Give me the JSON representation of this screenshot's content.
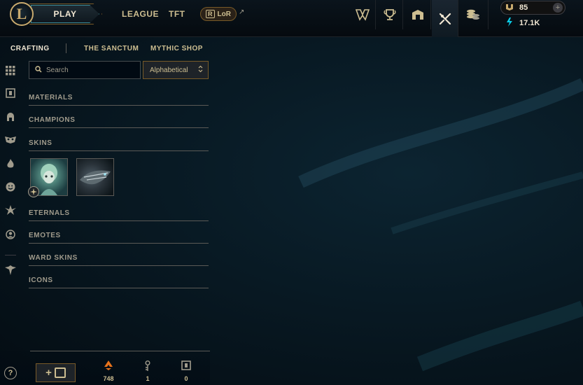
{
  "topbar": {
    "logo_letter": "L",
    "play_label": "PLAY",
    "nav": [
      "LEAGUE",
      "TFT"
    ],
    "lor_label": "LoR",
    "lor_ext_icon": "↗",
    "icons": [
      "worlds-icon",
      "trophy-icon",
      "collection-icon",
      "loot-icon",
      "store-icon"
    ]
  },
  "wallet": {
    "rp": "85",
    "blue_essence": "17.1K",
    "add_icon": "+"
  },
  "subnav": {
    "crafting": "CRAFTING",
    "sanctum": "THE SANCTUM",
    "mythic_shop": "MYTHIC SHOP"
  },
  "search": {
    "placeholder": "Search"
  },
  "sort": {
    "selected": "Alphabetical",
    "arrow": "⌃⌄"
  },
  "categories": {
    "materials": "MATERIALS",
    "champions": "CHAMPIONS",
    "skins": "SKINS",
    "eternals": "ETERNALS",
    "emotes": "EMOTES",
    "ward_skins": "WARD SKINS",
    "icons": "ICONS"
  },
  "bottom": {
    "orange_essence": "748",
    "keys": "1",
    "chests": "0",
    "help": "?"
  },
  "colors": {
    "gold": "#c8aa6e",
    "accent_teal": "#0acbe6",
    "orange": "#e8731c"
  }
}
